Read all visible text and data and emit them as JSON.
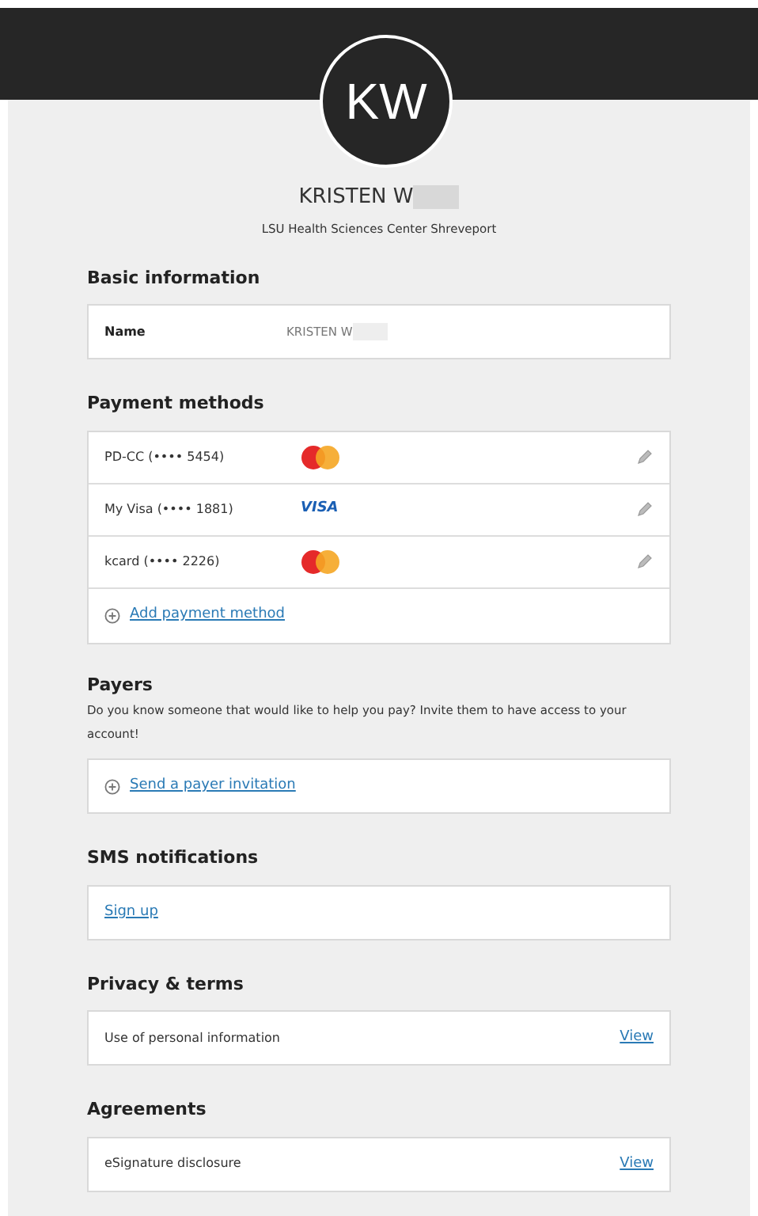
{
  "profile": {
    "initials": "KW",
    "name": "KRISTEN W",
    "organization": "LSU Health Sciences Center Shreveport"
  },
  "basic_information": {
    "heading": "Basic information",
    "label": "Name",
    "value": "KRISTEN W"
  },
  "payment_methods": {
    "heading": "Payment methods",
    "items": [
      {
        "label": "PD-CC (•••• 5454)",
        "kind": "mastercard"
      },
      {
        "label": "My Visa (•••• 1881)",
        "kind": "visa",
        "brand_text": "VISA"
      },
      {
        "label": "kcard (•••• 2226)",
        "kind": "mastercard"
      }
    ],
    "add_link": "Add payment method"
  },
  "payers": {
    "heading": "Payers",
    "description": "Do you know someone that would like to help you pay? Invite them to have access to your account!",
    "link": "Send a payer invitation"
  },
  "sms_notifications": {
    "heading": "SMS notifications",
    "link": "Sign up"
  },
  "privacy_terms": {
    "heading": "Privacy & terms",
    "item": "Use of personal information",
    "link": "View"
  },
  "agreements": {
    "heading": "Agreements",
    "item": "eSignature disclosure",
    "link": "View"
  }
}
